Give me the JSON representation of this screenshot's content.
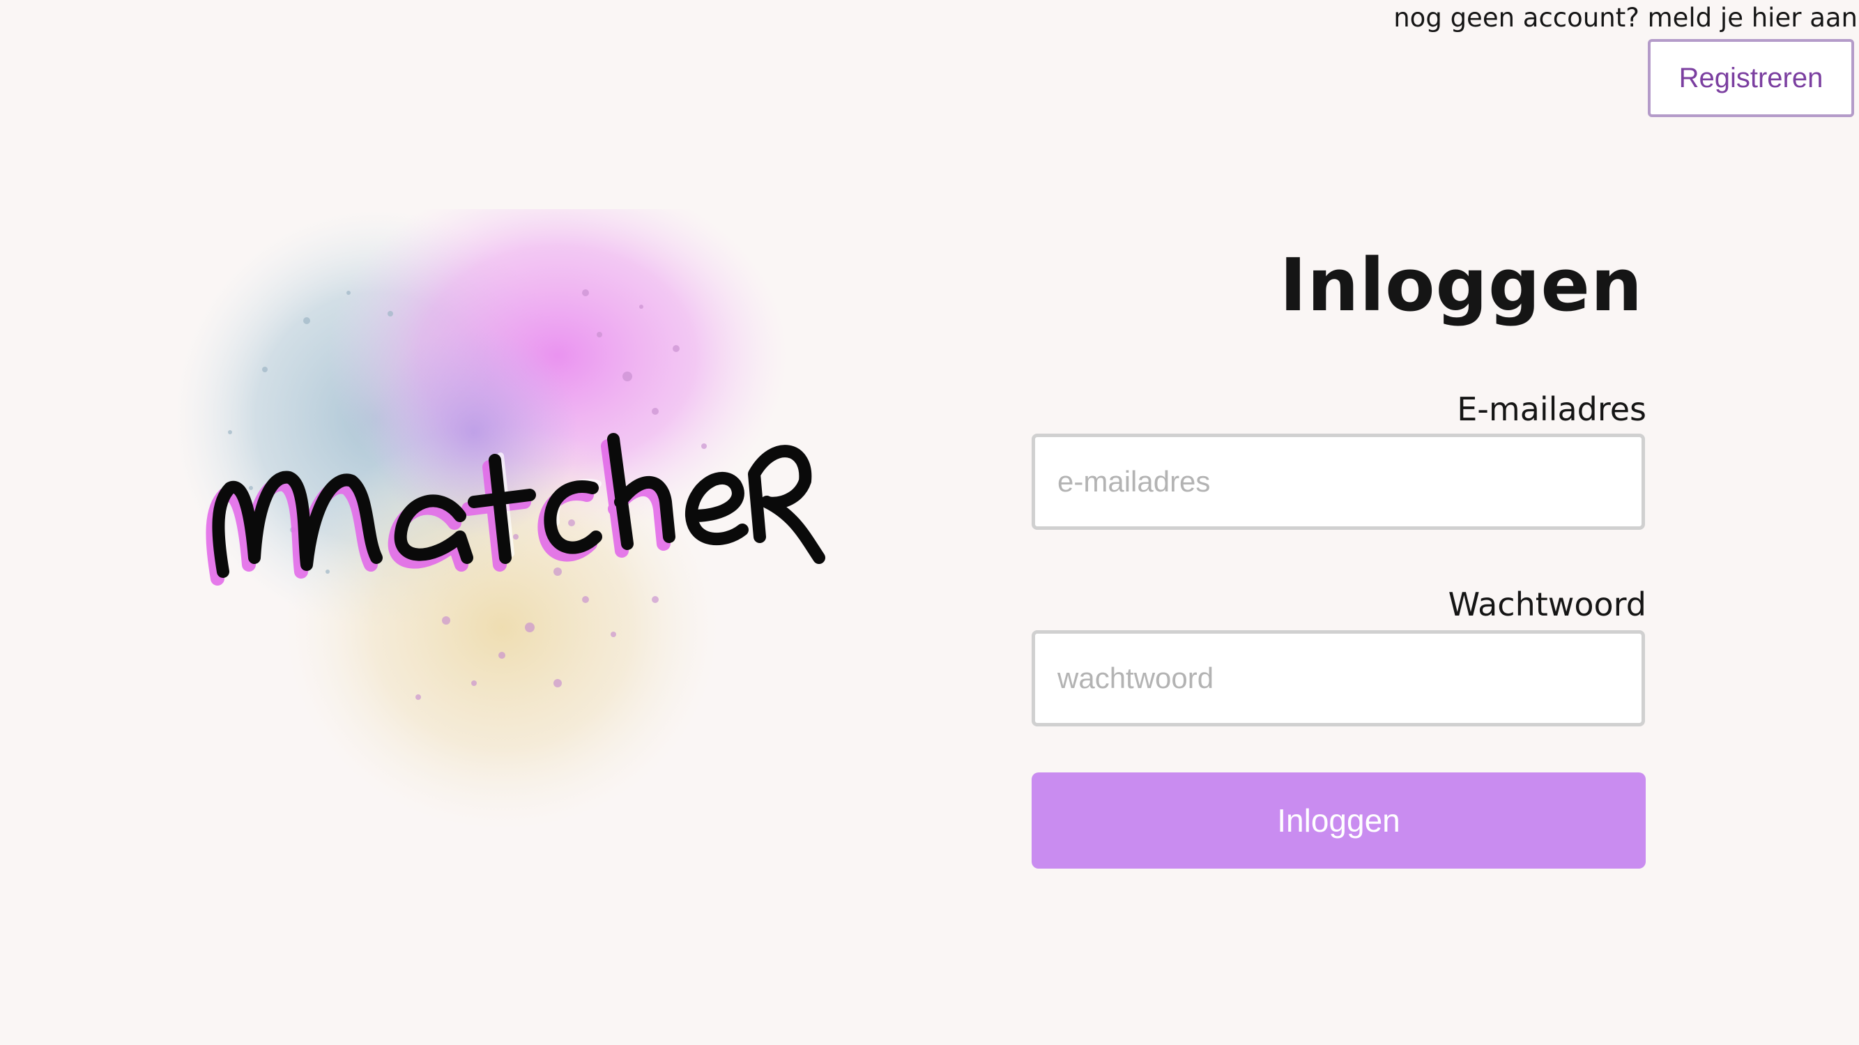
{
  "header": {
    "register_prompt": "nog geen account? meld je hier aan",
    "register_label": "Registreren"
  },
  "logo": {
    "text": "matcher",
    "colors": {
      "blue": "#a9c3d4",
      "pink": "#e98ef0",
      "yellow": "#eedcae",
      "purple": "#b79ae6",
      "ink": "#0a0a0a"
    }
  },
  "login_form": {
    "title": "Inloggen",
    "email_label": "E-mailadres",
    "email_placeholder": "e-mailadres",
    "password_label": "Wachtwoord",
    "password_placeholder": "wachtwoord",
    "submit_label": "Inloggen"
  },
  "colors": {
    "background": "#faf6f5",
    "accent": "#c98cf0",
    "register_text": "#7b3fa0",
    "register_border": "#b49bc9"
  }
}
